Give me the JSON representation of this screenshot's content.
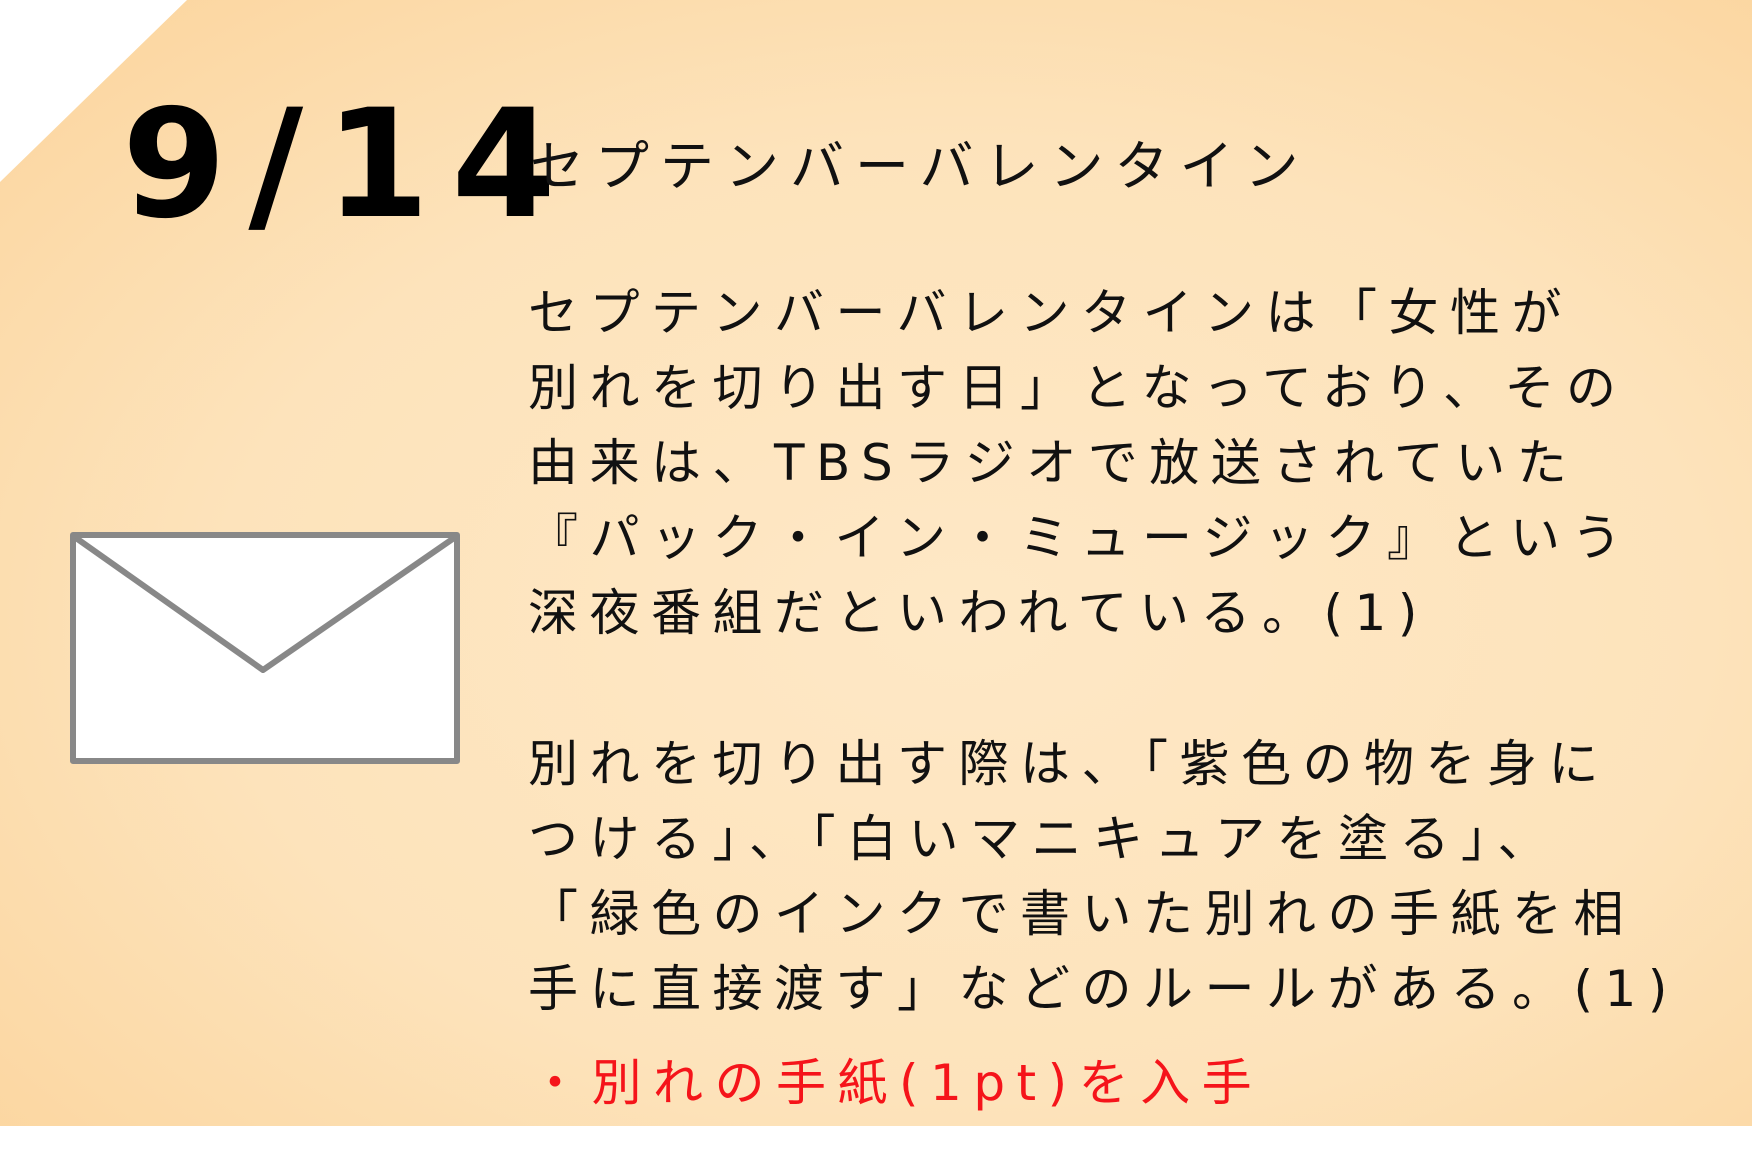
{
  "date": "9/14",
  "title": "セプテンバーバレンタイン",
  "paragraph1": [
    "セプテンバーバレンタインは「女性が",
    "別れを切り出す日」となっており、その",
    "由来は、TBSラジオで放送されていた",
    "『パック・イン・ミュージック』という",
    "深夜番組だといわれている。(1)"
  ],
  "paragraph2": [
    "別れを切り出す際は、「紫色の物を身に",
    "つける」、「白いマニキュアを塗る」、",
    "「緑色のインクで書いた別れの手紙を相",
    "手に直接渡す」などのルールがある。(1)"
  ],
  "reward": "・別れの手紙(1pt)を入手",
  "icon": "envelope-icon",
  "colors": {
    "background": "#fde3bb",
    "reward_text": "#f5141a",
    "envelope_stroke": "#888888"
  }
}
